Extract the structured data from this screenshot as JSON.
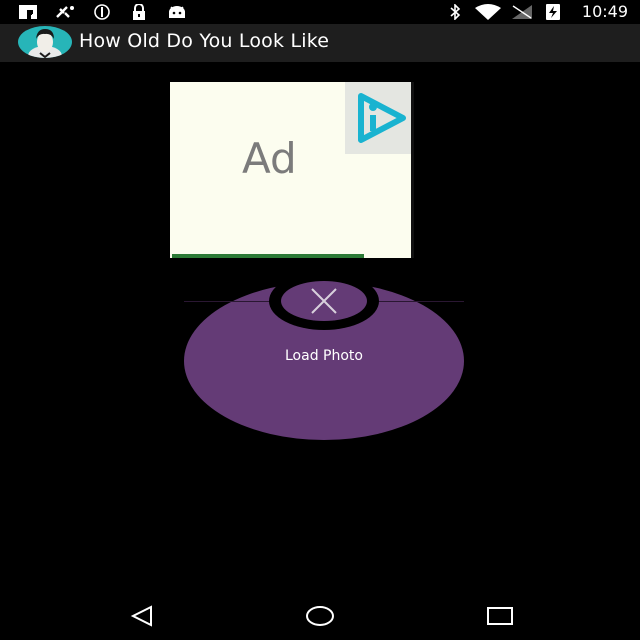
{
  "status_bar": {
    "time": "10:49",
    "left_icons": [
      "facebook-icon",
      "satellite-icon",
      "sync-icon",
      "lock-icon",
      "android-icon"
    ],
    "right_icons": [
      "bluetooth-icon",
      "wifi-icon",
      "signal-icon",
      "battery-charging-icon"
    ]
  },
  "app_bar": {
    "title": "How Old Do You Look Like",
    "icon": "face-avatar-icon"
  },
  "ad": {
    "label": "Ad",
    "choice_icon": "ad-choices-icon"
  },
  "load_photo": {
    "label": "Load Photo",
    "close_icon": "close-icon"
  },
  "nav_bar": {
    "buttons": [
      "back-icon",
      "home-icon",
      "recents-icon"
    ]
  },
  "colors": {
    "accent_purple": "#643b76",
    "app_bar": "#1e1e1e",
    "avatar_teal": "#27b5b8",
    "ad_background": "#fcfdef"
  }
}
